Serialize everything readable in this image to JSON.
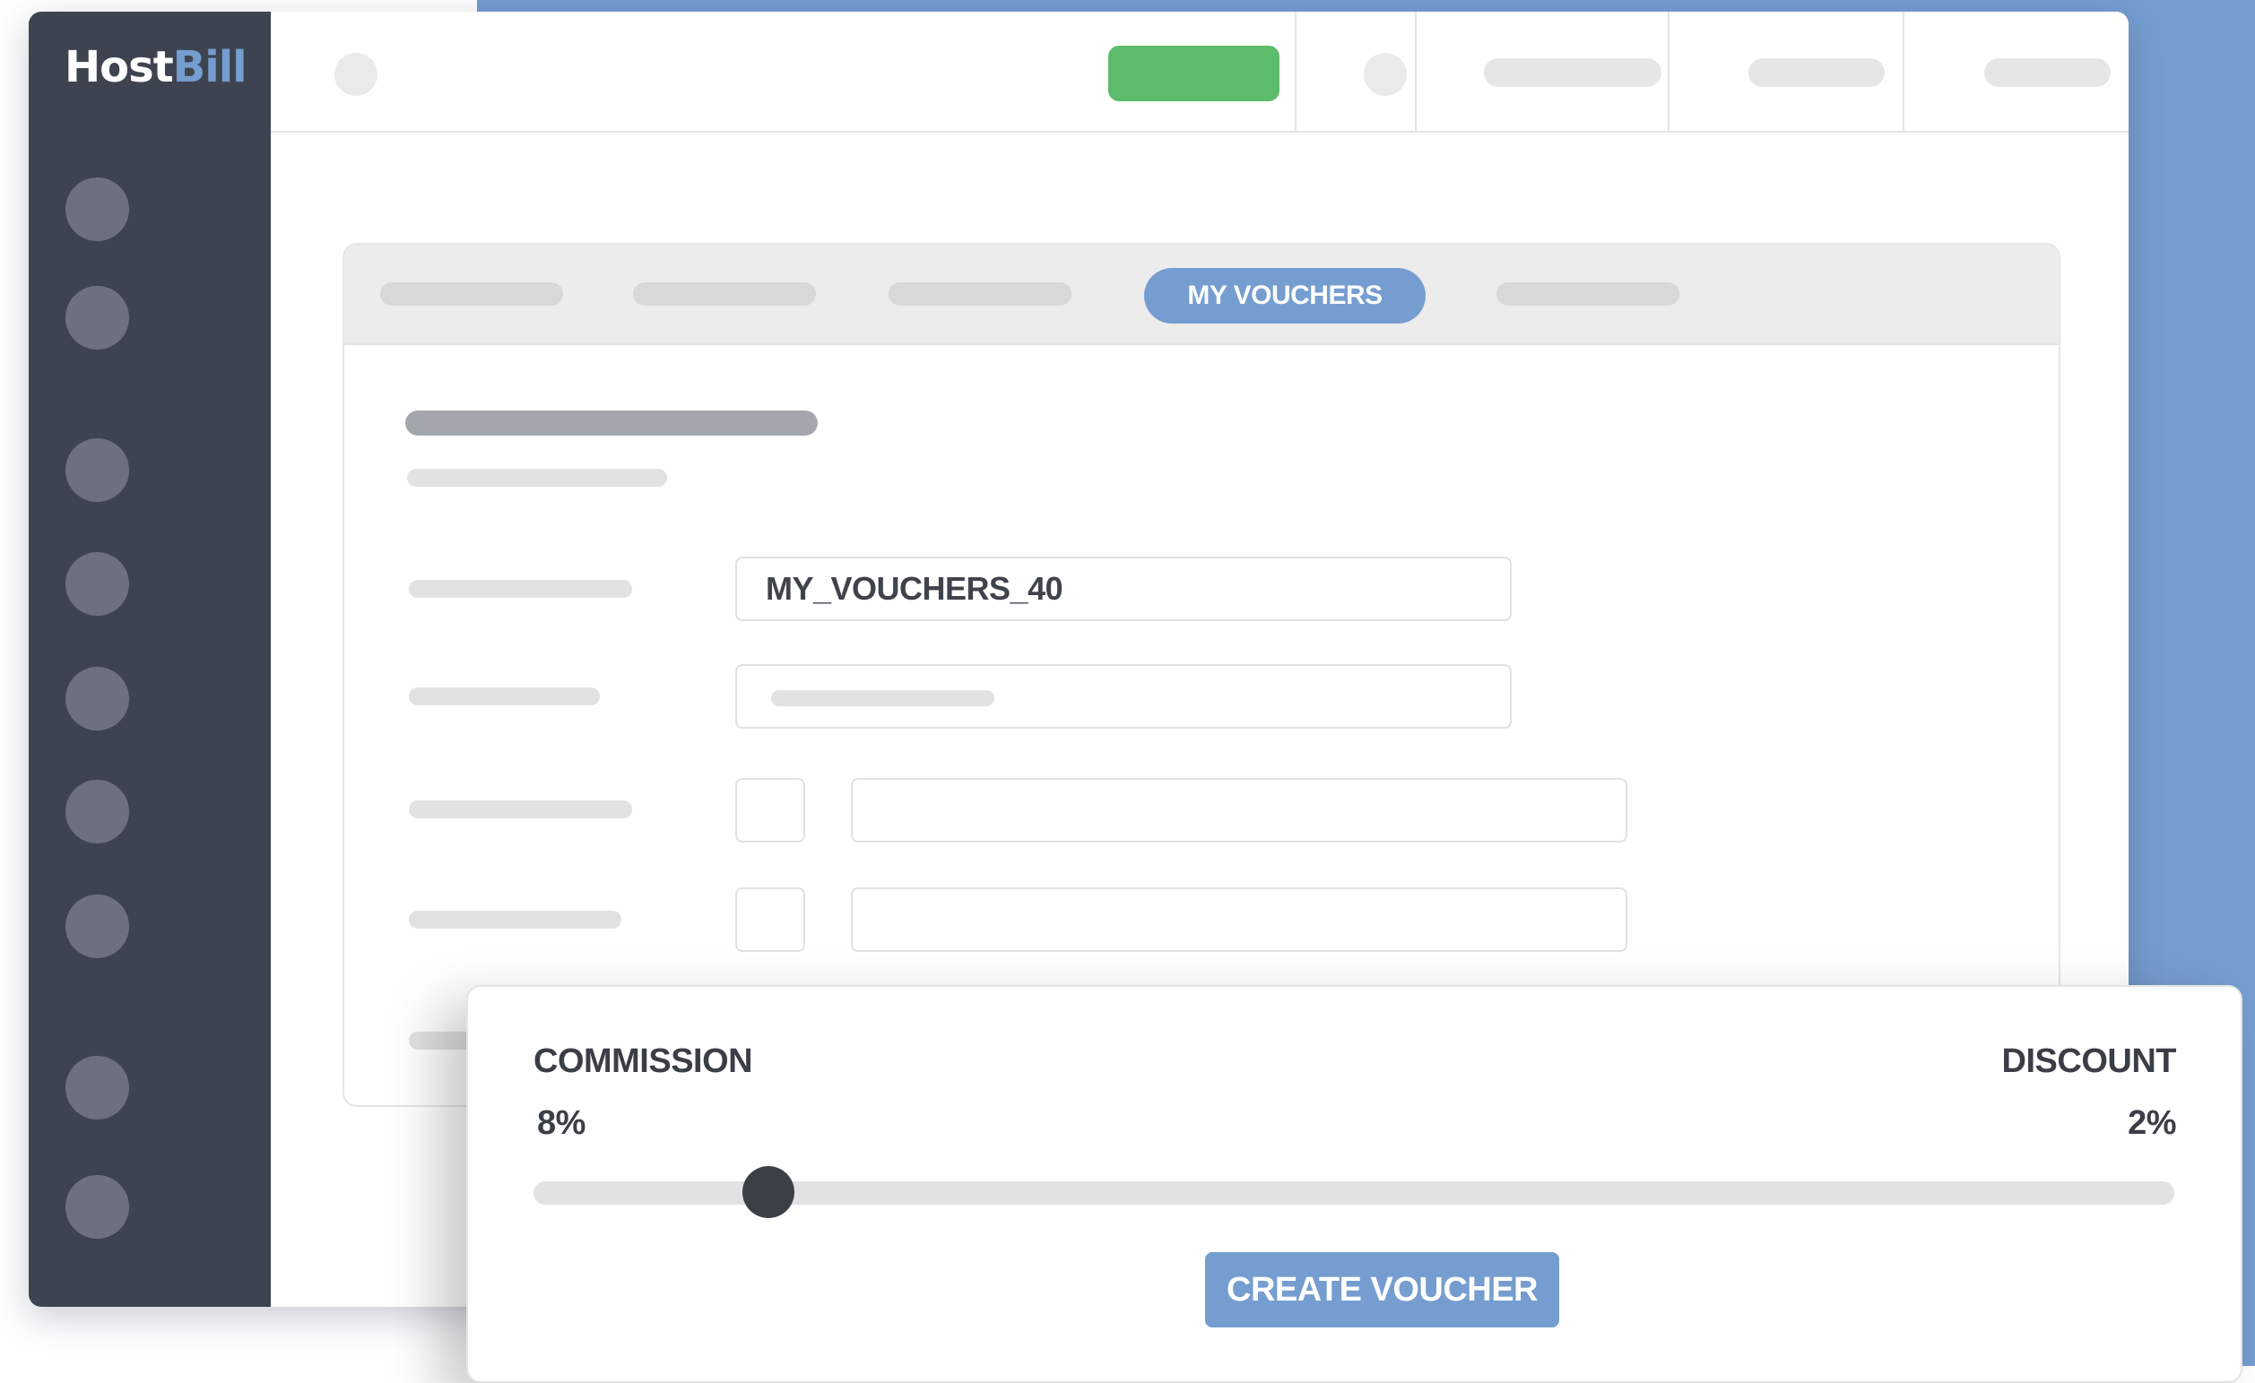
{
  "app": {
    "logo_part1": "Host",
    "logo_part2": "Bill"
  },
  "colors": {
    "accent": "#759dd0",
    "sidebar": "#3e444f",
    "success": "#5cbc6b"
  },
  "tabs": {
    "active_label": "MY VOUCHERS"
  },
  "form": {
    "voucher_code_value": "MY_VOUCHERS_40"
  },
  "commission_slider": {
    "left_label": "COMMISSION",
    "right_label": "DISCOUNT",
    "left_value": "8%",
    "right_value": "2%",
    "position_fraction": 0.143
  },
  "actions": {
    "create_label": "CREATE VOUCHER"
  }
}
